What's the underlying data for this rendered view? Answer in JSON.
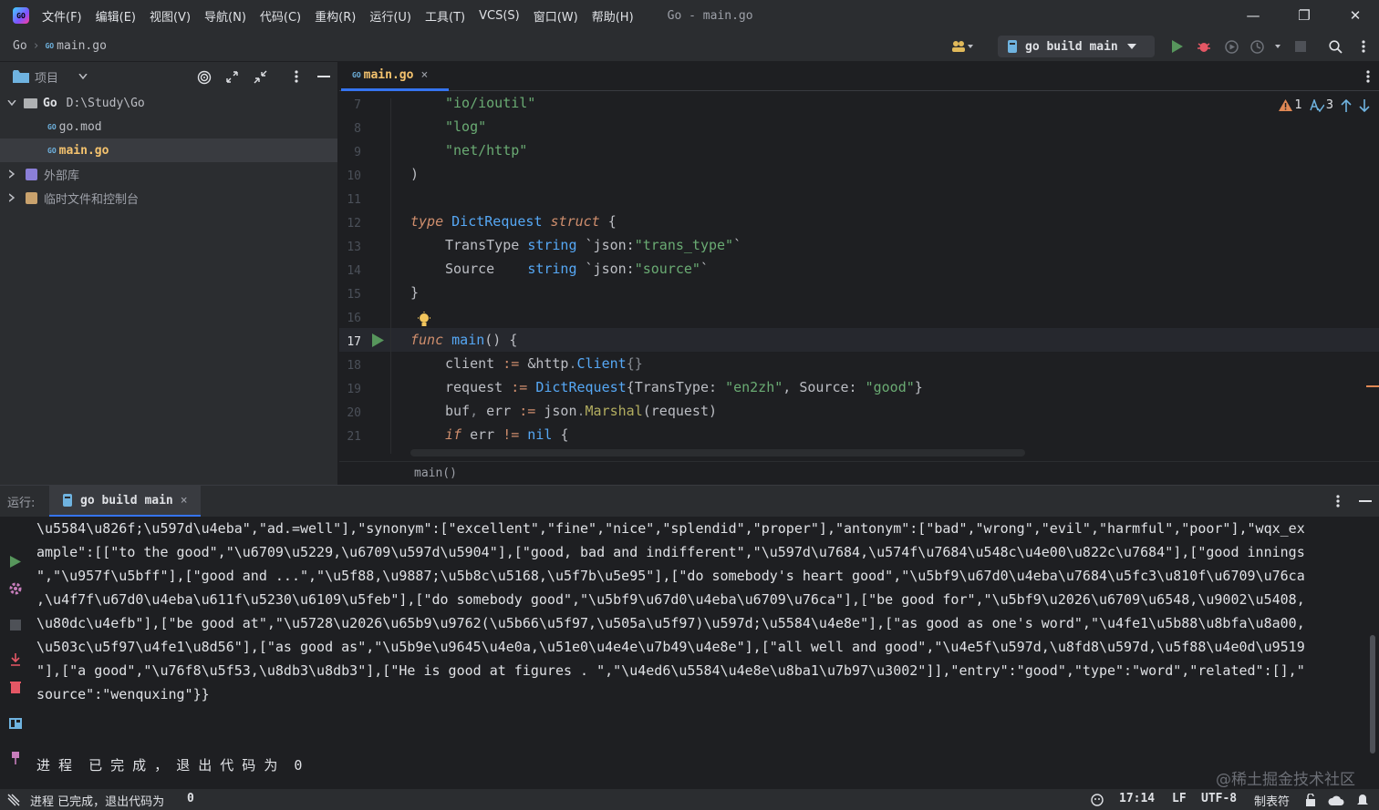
{
  "menubar": {
    "logo": "GO",
    "items": [
      "文件(F)",
      "编辑(E)",
      "视图(V)",
      "导航(N)",
      "代码(C)",
      "重构(R)",
      "运行(U)",
      "工具(T)",
      "VCS(S)",
      "窗口(W)",
      "帮助(H)"
    ],
    "window_title": "Go - main.go",
    "minimize": "—",
    "restore": "❐",
    "close": "✕"
  },
  "navbar": {
    "crumb_project": "Go",
    "crumb_sep": "›",
    "crumb_file": "main.go",
    "gopher": "GO",
    "run_config": "go build main"
  },
  "project": {
    "title": "项目",
    "tree": [
      {
        "label": "Go",
        "path": "D:\\Study\\Go"
      },
      {
        "label": "go.mod"
      },
      {
        "label": "main.go"
      },
      {
        "label": "外部库"
      },
      {
        "label": "临时文件和控制台"
      }
    ]
  },
  "editor": {
    "tab": "main.go",
    "tab_close": "×",
    "warnings": "1",
    "typos": "3",
    "bottom_breadcrumb": "main()",
    "line_numbers": [
      "7",
      "8",
      "9",
      "10",
      "11",
      "12",
      "13",
      "14",
      "15",
      "16",
      "17",
      "18",
      "19",
      "20",
      "21"
    ],
    "code": {
      "l7": "\"io/ioutil\"",
      "l8": "\"log\"",
      "l9": "\"net/http\"",
      "l10": ")",
      "l12_kw": "type",
      "l12_name": "DictRequest",
      "l12_kw2": "struct",
      "l12_brace": "{",
      "l13_field": "TransType",
      "l13_type": "string",
      "l13_tag1": "`json:",
      "l13_tag2": "\"trans_type\"",
      "l13_tag3": "`",
      "l14_field": "Source   ",
      "l14_type": "string",
      "l14_tag1": "`json:",
      "l14_tag2": "\"source\"",
      "l14_tag3": "`",
      "l15": "}",
      "l17_kw": "func",
      "l17_name": "main",
      "l17_rest": "() {",
      "l18_a": "client",
      "l18_b": " := ",
      "l18_c": "&http",
      "l18_d": ".",
      "l18_e": "Client",
      "l18_f": "{}",
      "l19_a": "request",
      "l19_b": " := ",
      "l19_c": "DictRequest",
      "l19_d": "{TransType: ",
      "l19_e": "\"en2zh\"",
      "l19_f": ", Source: ",
      "l19_g": "\"good\"",
      "l19_h": "}",
      "l20_a": "buf",
      "l20_b": ", ",
      "l20_c": "err",
      "l20_d": " := ",
      "l20_e": "json",
      "l20_f": ".",
      "l20_g": "Marshal",
      "l20_h": "(request)",
      "l21_a": "if",
      "l21_b": " err ",
      "l21_c": "!=",
      "l21_d": " nil ",
      "l21_e": "{"
    }
  },
  "run": {
    "label": "运行:",
    "tab": "go build main",
    "tab_close": "×",
    "console": [
      "\\u5584\\u826f;\\u597d\\u4eba\",\"ad.=well\"],\"synonym\":[\"excellent\",\"fine\",\"nice\",\"splendid\",\"proper\"],\"antonym\":[\"bad\",\"wrong\",\"evil\",\"harmful\",\"poor\"],\"wqx_ex",
      "ample\":[[\"to the good\",\"\\u6709\\u5229,\\u6709\\u597d\\u5904\"],[\"good, bad and indifferent\",\"\\u597d\\u7684,\\u574f\\u7684\\u548c\\u4e00\\u822c\\u7684\"],[\"good innings",
      "\",\"\\u957f\\u5bff\"],[\"good and ...\",\"\\u5f88,\\u9887;\\u5b8c\\u5168,\\u5f7b\\u5e95\"],[\"do somebody's heart good\",\"\\u5bf9\\u67d0\\u4eba\\u7684\\u5fc3\\u810f\\u6709\\u76ca",
      ",\\u4f7f\\u67d0\\u4eba\\u611f\\u5230\\u6109\\u5feb\"],[\"do somebody good\",\"\\u5bf9\\u67d0\\u4eba\\u6709\\u76ca\"],[\"be good for\",\"\\u5bf9\\u2026\\u6709\\u6548,\\u9002\\u5408,",
      "\\u80dc\\u4efb\"],[\"be good at\",\"\\u5728\\u2026\\u65b9\\u9762(\\u5b66\\u5f97,\\u505a\\u5f97)\\u597d;\\u5584\\u4e8e\"],[\"as good as one's word\",\"\\u4fe1\\u5b88\\u8bfa\\u8a00,",
      "\\u503c\\u5f97\\u4fe1\\u8d56\"],[\"as good as\",\"\\u5b9e\\u9645\\u4e0a,\\u51e0\\u4e4e\\u7b49\\u4e8e\"],[\"all well and good\",\"\\u4e5f\\u597d,\\u8fd8\\u597d,\\u5f88\\u4e0d\\u9519",
      "\"],[\"a good\",\"\\u76f8\\u5f53,\\u8db3\\u8db3\"],[\"He is good at figures . \",\"\\u4ed6\\u5584\\u4e8e\\u8ba1\\u7b97\\u3002\"]],\"entry\":\"good\",\"type\":\"word\",\"related\":[],\"",
      "source\":\"wenquxing\"}}",
      "",
      "",
      "进 程  已 完 成 ， 退 出 代 码 为  0"
    ],
    "watermark": "@稀土掘金技术社区"
  },
  "status": {
    "message": "进程 已完成，退出代码为",
    "code": "0",
    "position": "17:14",
    "line_ending": "LF",
    "encoding": "UTF-8",
    "indent": "制表符"
  },
  "colors": {
    "accent": "#3574f0",
    "run_green": "#57965c",
    "debug_red": "#e55765",
    "warning": "#e08855"
  }
}
